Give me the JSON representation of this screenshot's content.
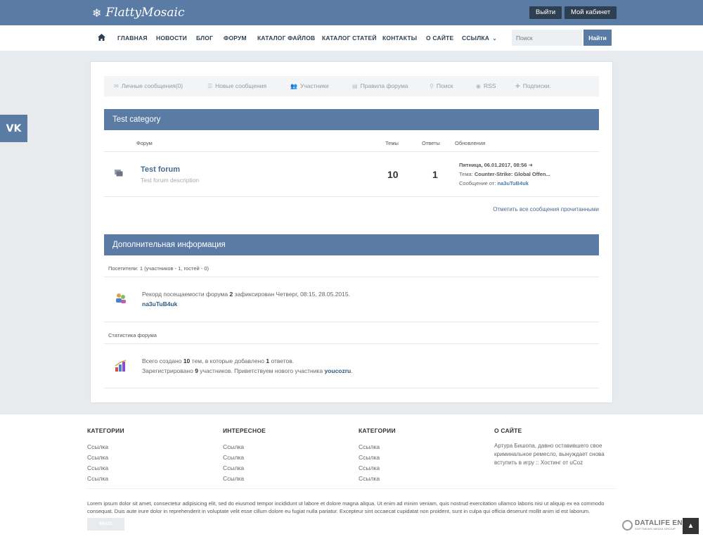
{
  "header": {
    "logo_text": "FlattyMosaic",
    "logout_label": "Выйти",
    "cabinet_label": "Мой кабинет"
  },
  "nav": {
    "items": [
      "Главная",
      "Новости",
      "Блог",
      "Форум",
      "Каталог файлов",
      "Каталог статей",
      "Контакты",
      "О сайте",
      "Ссылка"
    ],
    "search_placeholder": "Поиск",
    "search_button": "Найти"
  },
  "social": {
    "vk_label": "VK"
  },
  "forum_menu": {
    "items": [
      "Личные сообщения(0)",
      "Новые сообщения",
      "Участники",
      "Правила форума",
      "Поиск",
      "RSS",
      "Подписки."
    ]
  },
  "category": {
    "title": "Test category",
    "columns": {
      "forum": "Форум",
      "topics": "Темы",
      "replies": "Ответы",
      "updates": "Обновления"
    },
    "forum": {
      "title": "Test forum",
      "description": "Test forum description",
      "topics": "10",
      "replies": "1",
      "last_date": "Пятница, 06.01.2017, 08:56",
      "topic_label": "Тема:",
      "topic_value": "Counter-Strike: Global Offen...",
      "author_label": "Сообщение от:",
      "author_value": "na3uTuB4uk"
    },
    "mark_read": "Отметить все сообщения прочитанными"
  },
  "info": {
    "title": "Дополнительная информация",
    "visitors": "Посетители: 1  (участников - 1, гостей - 0)",
    "record": {
      "prefix": "Рекорд посещаемости форума",
      "count": "2",
      "suffix": "зафиксирован Четверг, 08:15, 28.05.2015.",
      "user": "na3uTuB4uk"
    },
    "stats_label": "Статистика форума",
    "stats": {
      "t1": "Всего создано",
      "topics": "10",
      "t2": "тем, в которые добавлено",
      "replies": "1",
      "t3": "ответов.",
      "t4": "Зарегистрировано",
      "users": "9",
      "t5": "участников. Приветствуем нового участника",
      "newuser": "youcozru",
      "t6": "."
    }
  },
  "footer": {
    "col1": {
      "title": "Категории",
      "links": [
        "Ссылка",
        "Ссылка",
        "Ссылка",
        "Ссылка"
      ]
    },
    "col2": {
      "title": "Интересное",
      "links": [
        "Ссылка",
        "Ссылка",
        "Ссылка",
        "Ссылка"
      ]
    },
    "col3": {
      "title": "Категории",
      "links": [
        "Ссылка",
        "Ссылка",
        "Ссылка",
        "Ссылка"
      ]
    },
    "col4": {
      "title": "О сайте",
      "text": "Артура Бишопа, давно оставившего свое криминальное ремесло, вынуждает снова вступить в игру :: Хостинг от uCoz"
    },
    "lorem": "Lorem ipsum dolor sit amet, consectetur adipisicing elit, sed do eiusmod tempor incididunt ut labore et dolore magna aliqua. Ut enim ad minim veniam, quis nostrud exercitation ullamco laboris nisi ut aliquip ex ea commodo consequat. Duis aute irure dolor in reprehenderit in voluptate velit esse cillum dolore eu fugiat nulla pariatur. Excepteur sint occaecat cupidatat non proident, sunt in culpa qui officia deserunt mollit anim id est laborum.",
    "button": "88X31",
    "dle_title": "DATALIFE ENG",
    "dle_sub": "SOFTNEWS MEDIA GROUP"
  }
}
